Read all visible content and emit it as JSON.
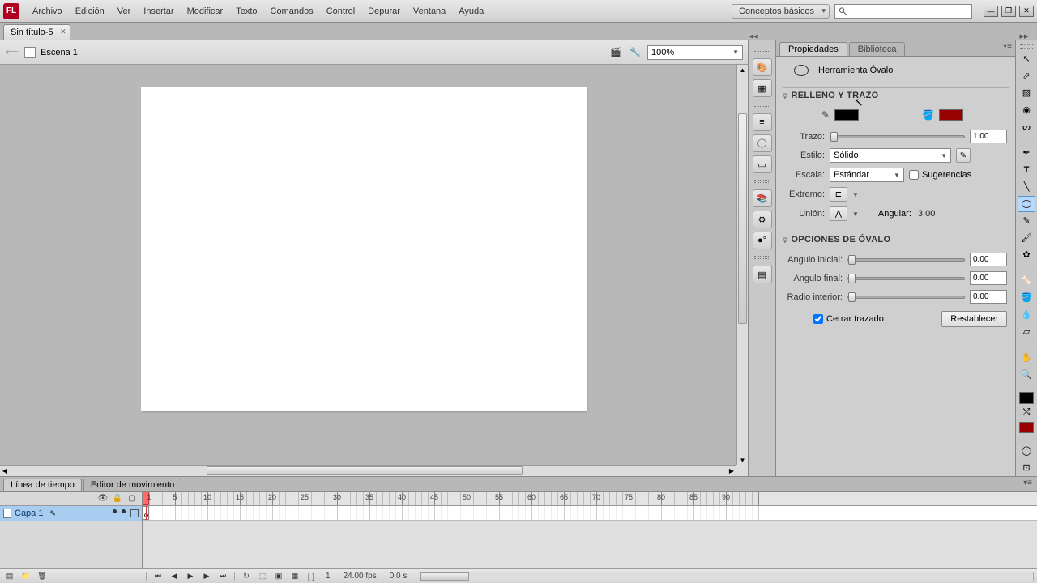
{
  "menu": [
    "Archivo",
    "Edición",
    "Ver",
    "Insertar",
    "Modificar",
    "Texto",
    "Comandos",
    "Control",
    "Depurar",
    "Ventana",
    "Ayuda"
  ],
  "workspace": "Conceptos básicos",
  "doc_tab": "Sin título-5",
  "scene": {
    "back_tip": "Atrás",
    "label": "Escena 1"
  },
  "zoom": "100%",
  "panel_tabs": {
    "properties": "Propiedades",
    "library": "Biblioteca"
  },
  "tool_name": "Herramienta Óvalo",
  "section_fillstroke": "RELLENO Y TRAZO",
  "stroke": {
    "label": "Trazo:",
    "value": "1.00"
  },
  "style": {
    "label": "Estilo:",
    "value": "Sólido"
  },
  "scale": {
    "label": "Escala:",
    "value": "Estándar",
    "hints": "Sugerencias"
  },
  "cap": {
    "label": "Extremo:"
  },
  "join": {
    "label": "Unión:",
    "miter_label": "Angular:",
    "miter_value": "3.00"
  },
  "section_oval": "OPCIONES DE ÓVALO",
  "oval": {
    "start": {
      "label": "Angulo inicial:",
      "value": "0.00"
    },
    "end": {
      "label": "Angulo final:",
      "value": "0.00"
    },
    "inner": {
      "label": "Radio interior:",
      "value": "0.00"
    },
    "close": "Cerrar trazado",
    "reset": "Restablecer"
  },
  "timeline": {
    "tab_timeline": "Línea de tiempo",
    "tab_motion": "Editor de movimiento",
    "layer_name": "Capa 1",
    "ticks": [
      1,
      5,
      10,
      15,
      20,
      25,
      30,
      35,
      40,
      45,
      50,
      55,
      60,
      65,
      70,
      75,
      80,
      85,
      90
    ],
    "current_frame": "1",
    "fps": "24.00 fps",
    "time": "0.0 s"
  },
  "colors": {
    "stroke": "#000000",
    "fill": "#990000"
  }
}
